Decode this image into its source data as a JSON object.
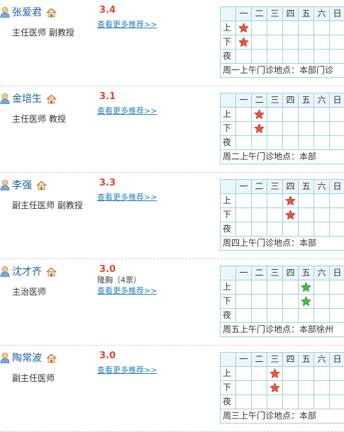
{
  "weekdays": [
    "一",
    "二",
    "三",
    "四",
    "五",
    "六",
    "日"
  ],
  "periods": [
    "上",
    "下",
    "夜"
  ],
  "more_label": "查看更多推荐>>",
  "colors": {
    "star_red": "#e8573b",
    "star_green": "#4cbb3a",
    "link": "#2c7fb8",
    "score": "#e0472d"
  },
  "icons": {
    "person": "user-icon",
    "home": "home-icon",
    "star": "star-icon"
  },
  "doctors": [
    {
      "name": "张爱君",
      "title": "主任医师  副教授",
      "score": "3.4",
      "votes": "",
      "schedule": {
        "上": [
          0
        ],
        "下": [
          0
        ],
        "夜": []
      },
      "star_color": "red",
      "location": "周一上午门诊地点：本部门诊"
    },
    {
      "name": "金培生",
      "title": "主任医师  教授",
      "score": "3.1",
      "votes": "",
      "schedule": {
        "上": [
          1
        ],
        "下": [
          1
        ],
        "夜": []
      },
      "star_color": "red",
      "location": "周二上午门诊地点：本部"
    },
    {
      "name": "李强",
      "title": "副主任医师  副教授",
      "score": "3.3",
      "votes": "",
      "schedule": {
        "上": [
          3
        ],
        "下": [
          3
        ],
        "夜": []
      },
      "star_color": "red",
      "location": "周四上午门诊地点：本部"
    },
    {
      "name": "沈才齐",
      "title": "主治医师",
      "score": "3.0",
      "votes": "隆胸（4票）",
      "schedule": {
        "上": [
          4
        ],
        "下": [
          4
        ],
        "夜": []
      },
      "star_color": "green",
      "location": "周五上午门诊地点：本部徐州"
    },
    {
      "name": "陶常波",
      "title": "副主任医师",
      "score": "3.0",
      "votes": "",
      "schedule": {
        "上": [
          2
        ],
        "下": [
          2
        ],
        "夜": []
      },
      "star_color": "red",
      "location": "周三上午门诊地点：本部"
    }
  ]
}
